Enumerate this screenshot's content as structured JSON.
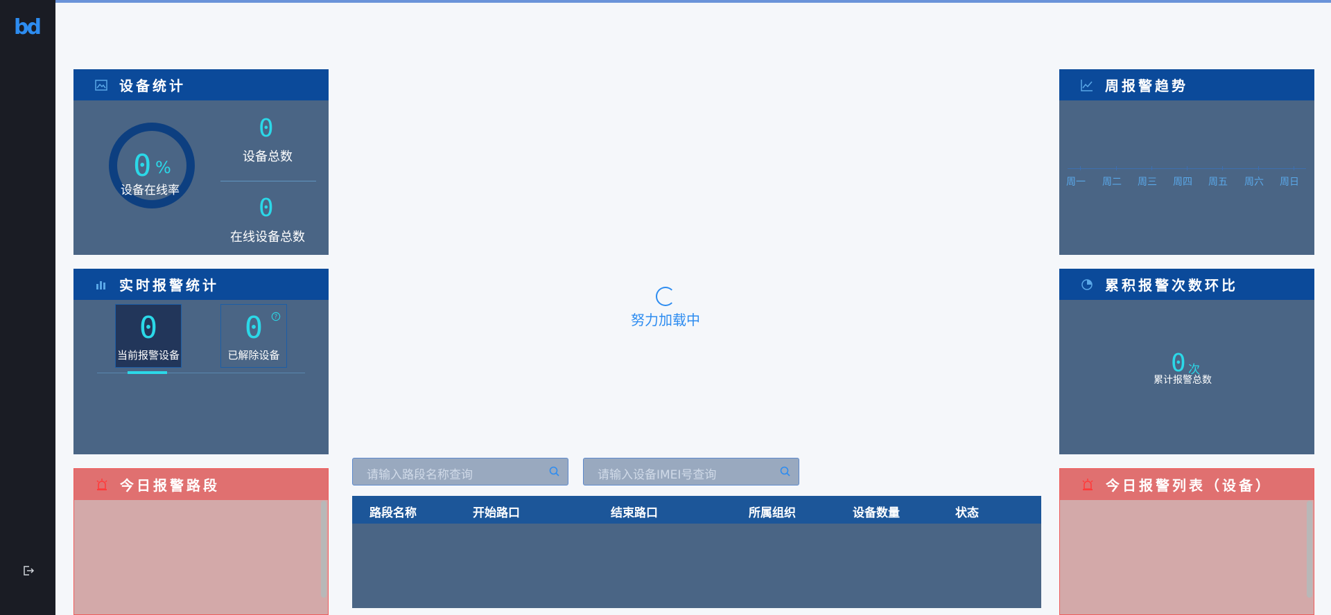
{
  "sidebar": {
    "logo": "bd",
    "logout_icon": "logout-icon"
  },
  "device_stats": {
    "title": "设备统计",
    "online_rate_value": "0",
    "online_rate_unit": "%",
    "online_rate_label": "设备在线率",
    "total_value": "0",
    "total_label": "设备总数",
    "online_total_value": "0",
    "online_total_label": "在线设备总数"
  },
  "realtime_alarm": {
    "title": "实时报警统计",
    "current_value": "0",
    "current_label": "当前报警设备",
    "resolved_value": "0",
    "resolved_label": "已解除设备",
    "help_icon": "question-icon"
  },
  "today_road_alarm": {
    "title": "今日报警路段"
  },
  "week_trend": {
    "title": "周报警趋势",
    "days": [
      "周一",
      "周二",
      "周三",
      "周四",
      "周五",
      "周六",
      "周日"
    ]
  },
  "cumulative": {
    "title": "累积报警次数环比",
    "value": "0",
    "unit": "次",
    "label": "累计报警总数"
  },
  "today_alarm_list": {
    "title": "今日报警列表（设备）"
  },
  "main": {
    "loading_text": "努力加载中",
    "search_road_placeholder": "请输入路段名称查询",
    "search_imei_placeholder": "请输入设备IMEI号查询",
    "table_headers": [
      "路段名称",
      "开始路口",
      "结束路口",
      "所属组织",
      "设备数量",
      "状态"
    ]
  },
  "colors": {
    "accent": "#2d8cf0",
    "digit": "#2bd8e8",
    "panel_header": "#0b4a9a",
    "alarm_header": "#e07070"
  }
}
